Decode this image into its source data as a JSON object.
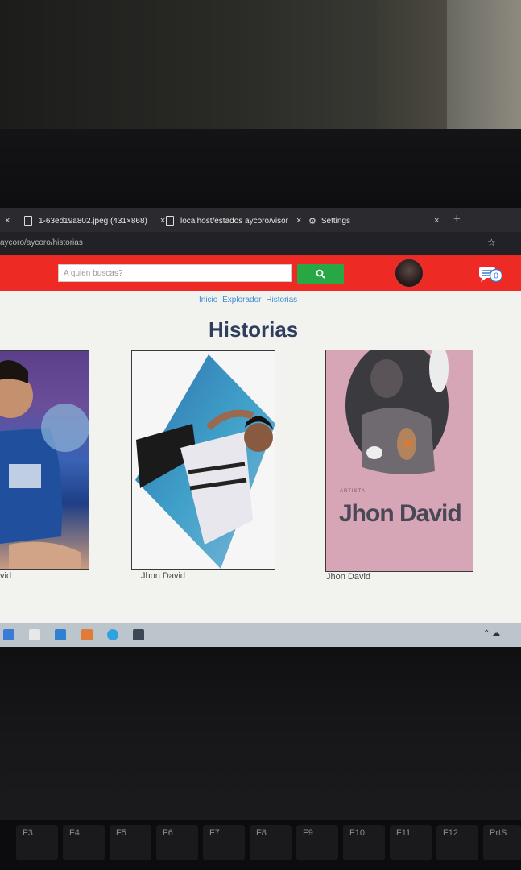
{
  "browser": {
    "tabs": [
      {
        "label": "1-63ed19a802.jpeg (431×868)"
      },
      {
        "label": "localhost/estados aycoro/visor"
      },
      {
        "label": "Settings"
      }
    ],
    "close_glyph": "×",
    "new_tab_glyph": "+",
    "url": "aycoro/aycoro/historias"
  },
  "header": {
    "search_placeholder": "A quien buscas?",
    "search_icon": "search-icon",
    "message_count": "0",
    "colors": {
      "bar": "#ee2a24",
      "search_button": "#28a745"
    }
  },
  "breadcrumb": [
    "Inicio",
    "Explorador",
    "Historias"
  ],
  "page_title": "Historias",
  "stories": [
    {
      "name": "vid",
      "art_text": ""
    },
    {
      "name": "Jhon David",
      "art_text": ""
    },
    {
      "name": "Jhon David",
      "art_label": "ARTISTA",
      "art_name": "Jhon David"
    }
  ],
  "keys": [
    "F3",
    "F4",
    "F5",
    "F6",
    "F7",
    "F8",
    "F9",
    "F10",
    "F11",
    "F12",
    "PrtS"
  ]
}
